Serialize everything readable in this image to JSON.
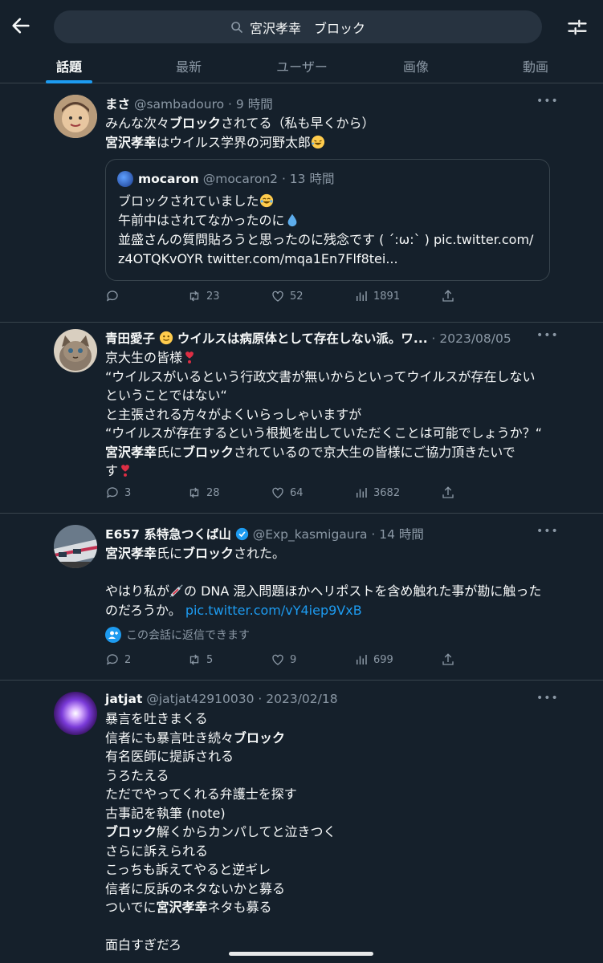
{
  "search": {
    "query": "宮沢孝幸　ブロック"
  },
  "tabs": [
    {
      "label": "話題"
    },
    {
      "label": "最新"
    },
    {
      "label": "ユーザー"
    },
    {
      "label": "画像"
    },
    {
      "label": "動画"
    }
  ],
  "colors": {
    "background": "#15202b",
    "accent": "#1d9bf0",
    "muted": "#8b98a5",
    "border": "#38444d"
  },
  "tweets": [
    {
      "name": "まさ",
      "meta": "@sambadouro · 9 時間",
      "lines": [
        [
          [
            "t",
            "みんな次々"
          ],
          [
            "b",
            "ブロック"
          ],
          [
            "t",
            "されてる（私も早くから）"
          ]
        ],
        [
          [
            "b",
            "宮沢孝幸"
          ],
          [
            "t",
            "はウイルス学界の河野太郎"
          ]
        ]
      ],
      "line_emojis": [
        "",
        "rolling-laughing-emoji"
      ],
      "quote": {
        "name": "mocaron",
        "meta": "@mocaron2 · 13 時間",
        "lines": [
          "ブロックされていました",
          "午前中はされてなかったのに",
          "並盛さんの質問貼ろうと思ったのに残念です ( ´:ω:` ) pic.twitter.com/",
          "z4OTQKvOYR twitter.com/mqa1En7Flf8tei..."
        ],
        "line_emojis": [
          "tears-of-joy-emoji",
          "droplet-emoji",
          "",
          ""
        ]
      },
      "stats": {
        "replies": "",
        "retweets": "23",
        "likes": "52",
        "views": "1891"
      }
    },
    {
      "name": "青田愛子",
      "name_rest": "ウイルスは病原体として存在しない派。ワ...",
      "meta": " · 2023/08/05",
      "lines": [
        [
          [
            "t",
            "京大生の皆様"
          ]
        ],
        [
          [
            "t",
            "“ウイルスがいるという行政文書が無いからといってウイルスが存在しない"
          ]
        ],
        [
          [
            "t",
            "ということではない“"
          ]
        ],
        [
          [
            "t",
            "と主張される方々がよくいらっしゃいますが"
          ]
        ],
        [
          [
            "t",
            "“ウイルスが存在するという根拠を出していただくことは可能でしょうか？“"
          ]
        ],
        [
          [
            "b",
            "宮沢孝幸"
          ],
          [
            "t",
            "氏に"
          ],
          [
            "b",
            "ブロック"
          ],
          [
            "t",
            "されているので京大生の皆様にご協力頂きたいで"
          ]
        ],
        [
          [
            "t",
            "す"
          ]
        ]
      ],
      "line_emojis": [
        "heart-exclamation-emoji",
        "",
        "",
        "",
        "",
        "",
        "heart-exclamation-emoji"
      ],
      "stats": {
        "replies": "3",
        "retweets": "28",
        "likes": "64",
        "views": "3682"
      }
    },
    {
      "name": "E657 系特急つくば山",
      "meta": "@Exp_kasmigaura · 14 時間",
      "lines": [
        [
          [
            "b",
            "宮沢孝幸"
          ],
          [
            "t",
            "氏に"
          ],
          [
            "b",
            "ブロック"
          ],
          [
            "t",
            "された。"
          ]
        ],
        [
          [
            "t",
            ""
          ]
        ],
        [
          [
            "t",
            "やはり私が"
          ],
          [
            "e",
            "syringe-emoji"
          ],
          [
            "t",
            "の DNA 混入問題ほかへリポストを含め触れた事が勘に触った"
          ]
        ],
        [
          [
            "t",
            "のだろうか。 "
          ],
          [
            "l",
            "pic.twitter.com/vY4iep9VxB"
          ]
        ]
      ],
      "line_emojis": [
        "",
        "",
        "",
        ""
      ],
      "reply_note": "この会話に返信できます",
      "stats": {
        "replies": "2",
        "retweets": "5",
        "likes": "9",
        "views": "699"
      }
    },
    {
      "name": "jatjat",
      "meta": "@jatjat42910030 · 2023/02/18",
      "lines": [
        [
          [
            "t",
            "暴言を吐きまくる"
          ]
        ],
        [
          [
            "t",
            "信者にも暴言吐き続々"
          ],
          [
            "b",
            "ブロック"
          ]
        ],
        [
          [
            "t",
            "有名医師に提訴される"
          ]
        ],
        [
          [
            "t",
            "うろたえる"
          ]
        ],
        [
          [
            "t",
            "ただでやってくれる弁護士を探す"
          ]
        ],
        [
          [
            "t",
            "古事記を執筆 (note)"
          ]
        ],
        [
          [
            "b",
            "ブロック"
          ],
          [
            "t",
            "解くからカンパしてと泣きつく"
          ]
        ],
        [
          [
            "t",
            "さらに訴えられる"
          ]
        ],
        [
          [
            "t",
            "こっちも訴えてやると逆ギレ"
          ]
        ],
        [
          [
            "t",
            "信者に反訴のネタないかと募る"
          ]
        ],
        [
          [
            "t",
            "ついでに"
          ],
          [
            "b",
            "宮沢孝幸"
          ],
          [
            "t",
            "ネタも募る"
          ]
        ],
        [
          [
            "t",
            ""
          ]
        ],
        [
          [
            "t",
            "面白すぎだろ"
          ]
        ]
      ],
      "line_emojis": [
        "",
        "",
        "",
        "",
        "",
        "",
        "",
        "",
        "",
        "",
        "",
        "",
        ""
      ]
    }
  ]
}
